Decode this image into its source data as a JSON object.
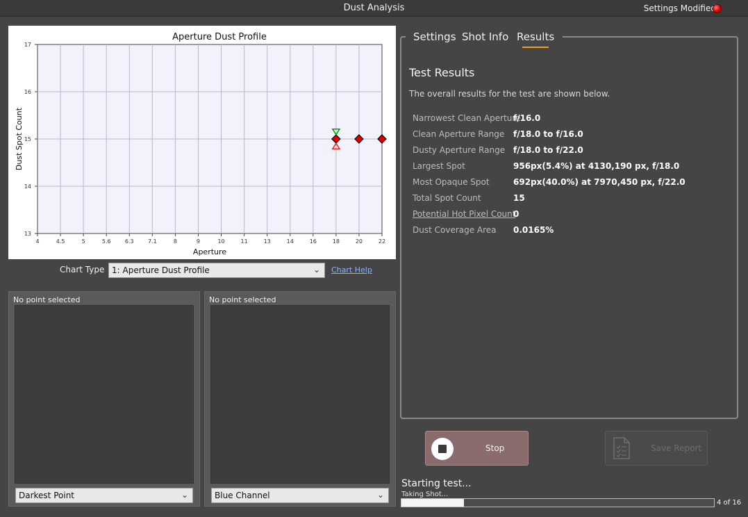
{
  "window": {
    "title": "Dust Analysis",
    "modified_label": "Settings Modified",
    "modified_color": "#e00000"
  },
  "chart_data": {
    "type": "scatter",
    "title": "Aperture Dust Profile",
    "xlabel": "Aperture",
    "ylabel": "Dust Spot Count",
    "x_ticks": [
      "4",
      "4.5",
      "5",
      "5.6",
      "6.3",
      "7.1",
      "8",
      "9",
      "10",
      "11",
      "13",
      "14",
      "16",
      "18",
      "20",
      "22"
    ],
    "y_ticks": [
      "13",
      "14",
      "15",
      "16",
      "17"
    ],
    "ylim": [
      13,
      17
    ],
    "grid": true,
    "series": [
      {
        "marker": "diamond",
        "color": "#e00000",
        "points": [
          {
            "x": "18",
            "y": 15
          },
          {
            "x": "20",
            "y": 15
          },
          {
            "x": "22",
            "y": 15
          }
        ]
      },
      {
        "marker": "triangle-down",
        "color": "#00a000",
        "points": [
          {
            "x": "18",
            "y": 15.15
          }
        ]
      },
      {
        "marker": "triangle-up",
        "color": "#ff2020",
        "points": [
          {
            "x": "18",
            "y": 14.85
          }
        ]
      }
    ]
  },
  "chart_controls": {
    "type_label": "Chart Type",
    "type_value": "1: Aperture Dust Profile",
    "help_link": "Chart Help"
  },
  "panels": [
    {
      "caption": "No point selected",
      "select_value": "Darkest Point"
    },
    {
      "caption": "No point selected",
      "select_value": "Blue Channel"
    }
  ],
  "tabs": [
    {
      "label": "Settings",
      "active": false
    },
    {
      "label": "Shot Info",
      "active": false
    },
    {
      "label": "Results",
      "active": true
    }
  ],
  "results": {
    "title": "Test Results",
    "description": "The overall results for the test are shown below.",
    "rows": [
      {
        "key": "Narrowest Clean Aperture",
        "value": "f/16.0",
        "link": false
      },
      {
        "key": "Clean Aperture Range",
        "value": "f/18.0 to f/16.0",
        "link": false
      },
      {
        "key": "Dusty Aperture Range",
        "value": "f/18.0 to f/22.0",
        "link": false
      },
      {
        "key": "Largest Spot",
        "value": "956px(5.4%) at 4130,190 px, f/18.0",
        "link": false
      },
      {
        "key": "Most Opaque Spot",
        "value": "692px(40.0%) at 7970,450 px, f/22.0",
        "link": false
      },
      {
        "key": "Total Spot Count",
        "value": "15",
        "link": false
      },
      {
        "key": "Potential Hot Pixel Count",
        "value": "0",
        "link": true
      },
      {
        "key": "Dust Coverage Area",
        "value": "0.0165%",
        "link": false
      }
    ]
  },
  "buttons": {
    "stop": "Stop",
    "save_report": "Save Report"
  },
  "status": {
    "main": "Starting test...",
    "sub": "Taking Shot...",
    "progress_fraction": 0.2,
    "count": "4 of 16"
  }
}
